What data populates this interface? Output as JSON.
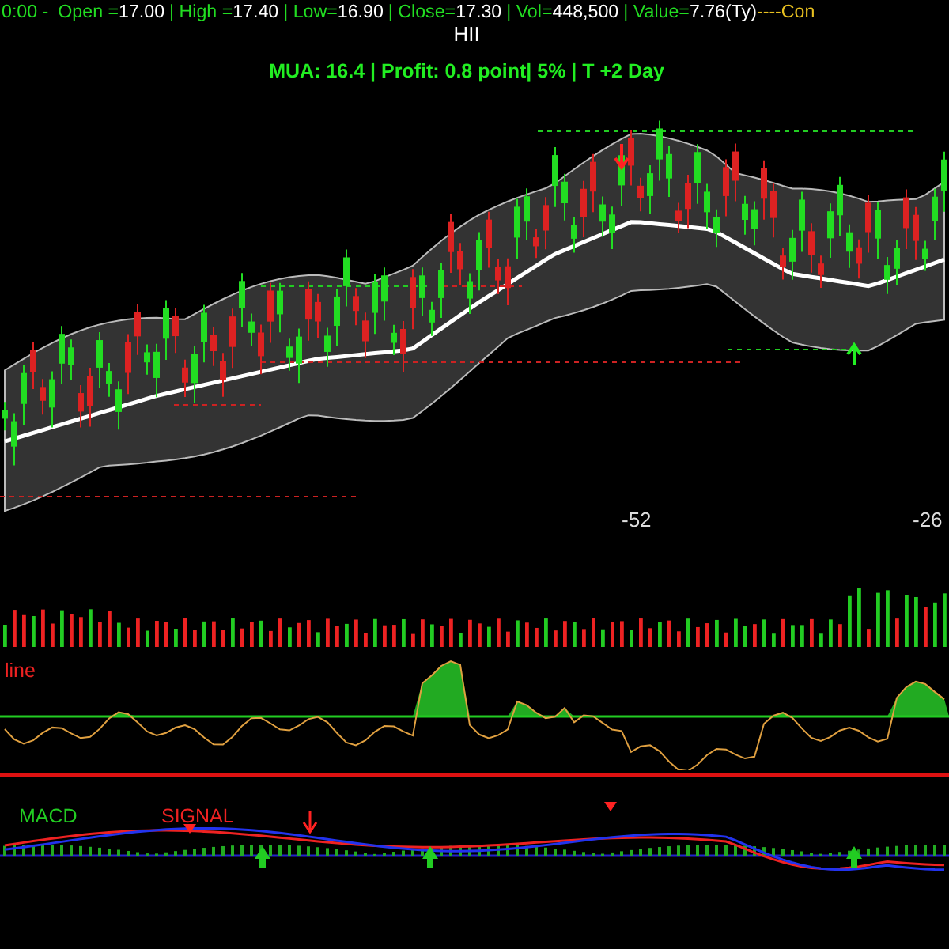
{
  "quote_bar": {
    "time": "0:00 -",
    "items": [
      {
        "label": "Open =",
        "value": "17.00"
      },
      {
        "label": "| High =",
        "value": "17.40"
      },
      {
        "label": "| Low=",
        "value": "16.90"
      },
      {
        "label": "| Close=",
        "value": "17.30"
      },
      {
        "label": "| Vol=",
        "value": "448,500"
      },
      {
        "label": "| Value=",
        "value": "7.76(Ty)"
      }
    ],
    "suffix": "----Con"
  },
  "symbol": "HII",
  "summary": "MUA:  16.4 | Profit: 0.8 point| 5% | T +2 Day",
  "price_panel": {
    "markers": [
      "-52",
      "-26"
    ]
  },
  "oscillator_panel": {
    "label": "line"
  },
  "macd_panel": {
    "labels": [
      "MACD",
      "SIGNAL"
    ]
  }
}
